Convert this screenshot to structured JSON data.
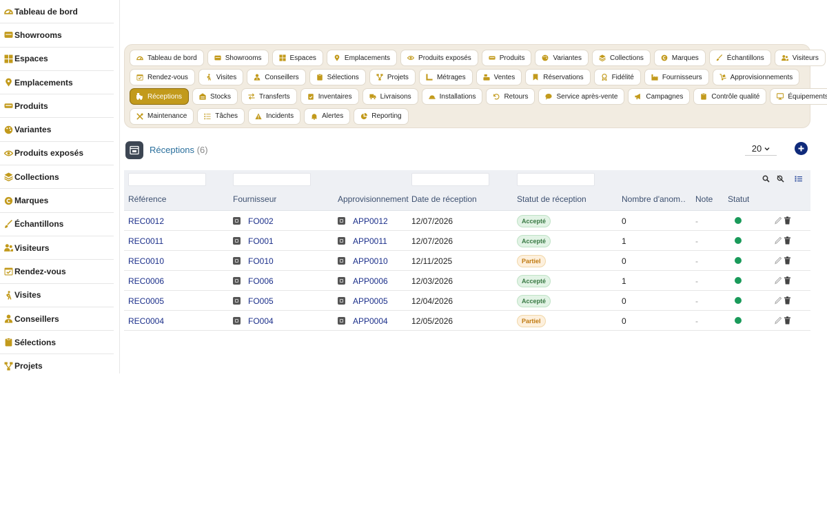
{
  "sidebar": {
    "items": [
      {
        "label": "Tableau de bord",
        "icon": "dashboard-icon"
      },
      {
        "label": "Showrooms",
        "icon": "showroom-icon"
      },
      {
        "label": "Espaces",
        "icon": "grid-icon"
      },
      {
        "label": "Emplacements",
        "icon": "map-pin-icon"
      },
      {
        "label": "Produits",
        "icon": "couch-icon"
      },
      {
        "label": "Variantes",
        "icon": "palette-icon"
      },
      {
        "label": "Produits exposés",
        "icon": "eye-icon"
      },
      {
        "label": "Collections",
        "icon": "layers-icon"
      },
      {
        "label": "Marques",
        "icon": "copyright-icon"
      },
      {
        "label": "Échantillons",
        "icon": "brush-icon"
      },
      {
        "label": "Visiteurs",
        "icon": "users-icon"
      },
      {
        "label": "Rendez-vous",
        "icon": "calendar-check-icon"
      },
      {
        "label": "Visites",
        "icon": "walking-icon"
      },
      {
        "label": "Conseillers",
        "icon": "user-tie-icon"
      },
      {
        "label": "Sélections",
        "icon": "clipboard-icon"
      },
      {
        "label": "Projets",
        "icon": "project-icon"
      }
    ]
  },
  "tabs": {
    "rows": [
      [
        {
          "label": "Tableau de bord",
          "icon": "dashboard-icon"
        },
        {
          "label": "Showrooms",
          "icon": "showroom-icon"
        },
        {
          "label": "Espaces",
          "icon": "grid-icon"
        },
        {
          "label": "Emplacements",
          "icon": "map-pin-icon"
        },
        {
          "label": "Produits exposés",
          "icon": "eye-icon"
        },
        {
          "label": "Produits",
          "icon": "couch-icon"
        },
        {
          "label": "Variantes",
          "icon": "palette-icon"
        },
        {
          "label": "Collections",
          "icon": "layers-icon"
        },
        {
          "label": "Marques",
          "icon": "copyright-icon"
        },
        {
          "label": "Échantillons",
          "icon": "brush-icon"
        },
        {
          "label": "Visiteurs",
          "icon": "users-icon"
        }
      ],
      [
        {
          "label": "Rendez-vous",
          "icon": "calendar-check-icon"
        },
        {
          "label": "Visites",
          "icon": "walking-icon"
        },
        {
          "label": "Conseillers",
          "icon": "user-tie-icon"
        },
        {
          "label": "Sélections",
          "icon": "clipboard-icon"
        },
        {
          "label": "Projets",
          "icon": "project-icon"
        },
        {
          "label": "Métrages",
          "icon": "ruler-icon"
        },
        {
          "label": "Ventes",
          "icon": "cash-register-icon"
        },
        {
          "label": "Réservations",
          "icon": "bookmark-icon"
        },
        {
          "label": "Fidélité",
          "icon": "award-icon"
        },
        {
          "label": "Fournisseurs",
          "icon": "industry-icon"
        },
        {
          "label": "Approvisionnements",
          "icon": "dolly-icon"
        }
      ],
      [
        {
          "label": "Réceptions",
          "icon": "truck-loading-icon",
          "active": true
        },
        {
          "label": "Stocks",
          "icon": "warehouse-icon"
        },
        {
          "label": "Transferts",
          "icon": "exchange-icon"
        },
        {
          "label": "Inventaires",
          "icon": "clipboard-check-icon"
        },
        {
          "label": "Livraisons",
          "icon": "truck-icon"
        },
        {
          "label": "Installations",
          "icon": "hard-hat-icon"
        },
        {
          "label": "Retours",
          "icon": "undo-icon"
        },
        {
          "label": "Service après-vente",
          "icon": "comment-icon"
        },
        {
          "label": "Campagnes",
          "icon": "bullhorn-icon"
        },
        {
          "label": "Contrôle qualité",
          "icon": "clipboard-icon"
        },
        {
          "label": "Équipements",
          "icon": "desktop-icon"
        }
      ],
      [
        {
          "label": "Maintenance",
          "icon": "tools-icon"
        },
        {
          "label": "Tâches",
          "icon": "tasks-icon"
        },
        {
          "label": "Incidents",
          "icon": "warning-icon"
        },
        {
          "label": "Alertes",
          "icon": "bell-icon"
        },
        {
          "label": "Reporting",
          "icon": "pie-chart-icon"
        }
      ]
    ]
  },
  "list": {
    "title": "Réceptions",
    "count": "(6)",
    "page_size": "20"
  },
  "table": {
    "columns": [
      "Référence",
      "Fournisseur",
      "Approvisionnement",
      "Date de réception",
      "Statut de réception",
      "Nombre d'anom…",
      "Note",
      "Statut"
    ],
    "rows": [
      {
        "ref": "REC0012",
        "fournisseur": "FO002",
        "appro": "APP0012",
        "date": "12/07/2026",
        "statut_reception": "Accepté",
        "anomalies": "0",
        "note": "-",
        "statut": "active"
      },
      {
        "ref": "REC0011",
        "fournisseur": "FO001",
        "appro": "APP0011",
        "date": "12/07/2026",
        "statut_reception": "Accepté",
        "anomalies": "1",
        "note": "-",
        "statut": "active"
      },
      {
        "ref": "REC0010",
        "fournisseur": "FO010",
        "appro": "APP0010",
        "date": "12/11/2025",
        "statut_reception": "Partiel",
        "anomalies": "0",
        "note": "-",
        "statut": "active"
      },
      {
        "ref": "REC0006",
        "fournisseur": "FO006",
        "appro": "APP0006",
        "date": "12/03/2026",
        "statut_reception": "Accepté",
        "anomalies": "1",
        "note": "-",
        "statut": "active"
      },
      {
        "ref": "REC0005",
        "fournisseur": "FO005",
        "appro": "APP0005",
        "date": "12/04/2026",
        "statut_reception": "Accepté",
        "anomalies": "0",
        "note": "-",
        "statut": "active"
      },
      {
        "ref": "REC0004",
        "fournisseur": "FO004",
        "appro": "APP0004",
        "date": "12/05/2026",
        "statut_reception": "Partiel",
        "anomalies": "0",
        "note": "-",
        "statut": "active"
      }
    ]
  },
  "colors": {
    "accent": "#c29a1c",
    "link": "#1b2f8a",
    "title": "#2a6f9c",
    "status_active": "#1a9a5a",
    "add_button": "#0f2a7a",
    "panel_bg": "#f2ece1"
  }
}
